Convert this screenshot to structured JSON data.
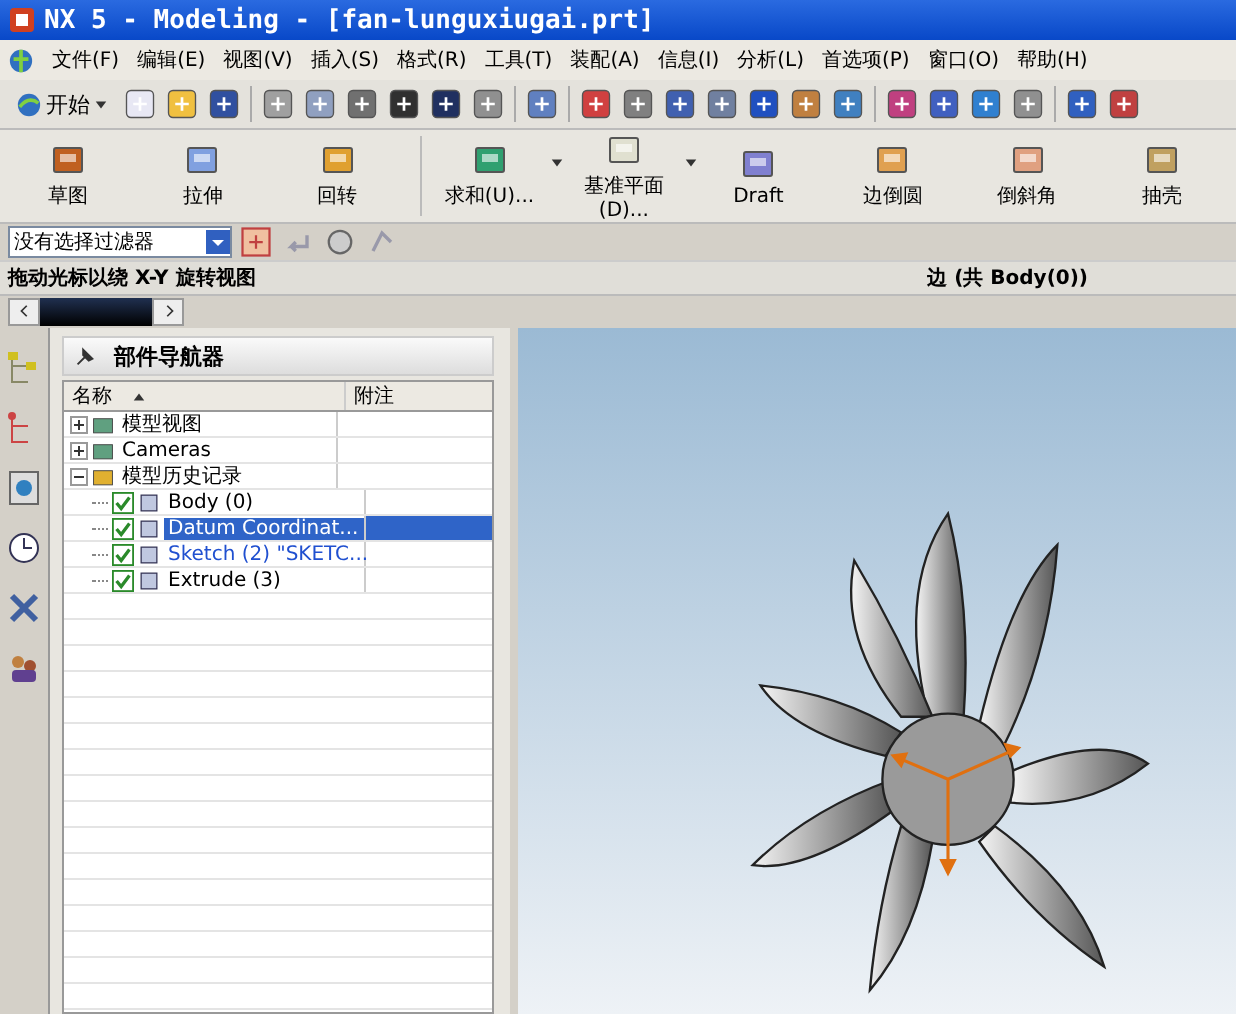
{
  "window": {
    "title": "NX 5 - Modeling - [fan-lunguxiugai.prt]"
  },
  "menu": [
    "文件(F)",
    "编辑(E)",
    "视图(V)",
    "插入(S)",
    "格式(R)",
    "工具(T)",
    "装配(A)",
    "信息(I)",
    "分析(L)",
    "首选项(P)",
    "窗口(O)",
    "帮助(H)"
  ],
  "start_button": "开始",
  "feature_toolbar": [
    {
      "label": "草图",
      "dropdown": false
    },
    {
      "label": "拉伸",
      "dropdown": false
    },
    {
      "label": "回转",
      "dropdown": false
    },
    {
      "label": "求和(U)...",
      "dropdown": true
    },
    {
      "label": "基准平面(D)...",
      "dropdown": true
    },
    {
      "label": "Draft",
      "dropdown": false
    },
    {
      "label": "边倒圆",
      "dropdown": false
    },
    {
      "label": "倒斜角",
      "dropdown": false
    },
    {
      "label": "抽壳",
      "dropdown": false
    }
  ],
  "filter": {
    "value": "没有选择过滤器"
  },
  "status": {
    "prompt": "拖动光标以绕 X-Y 旋转视图",
    "selection": "边 (共 Body(0))"
  },
  "navigator": {
    "title": "部件导航器",
    "columns": [
      "名称",
      "附注"
    ],
    "tree": [
      {
        "label": "模型视图",
        "expanded": false,
        "selected": false
      },
      {
        "label": "Cameras",
        "expanded": false,
        "selected": false
      },
      {
        "label": "模型历史记录",
        "expanded": true,
        "selected": false,
        "children": [
          {
            "label": "Body (0)",
            "checked": true,
            "selected": false,
            "highlighted": false
          },
          {
            "label": "Datum Coordinat...",
            "checked": true,
            "selected": true,
            "highlighted": false
          },
          {
            "label": "Sketch (2) \"SKETC...",
            "checked": true,
            "selected": false,
            "highlighted": true
          },
          {
            "label": "Extrude (3)",
            "checked": true,
            "selected": false,
            "highlighted": false
          }
        ]
      }
    ]
  }
}
